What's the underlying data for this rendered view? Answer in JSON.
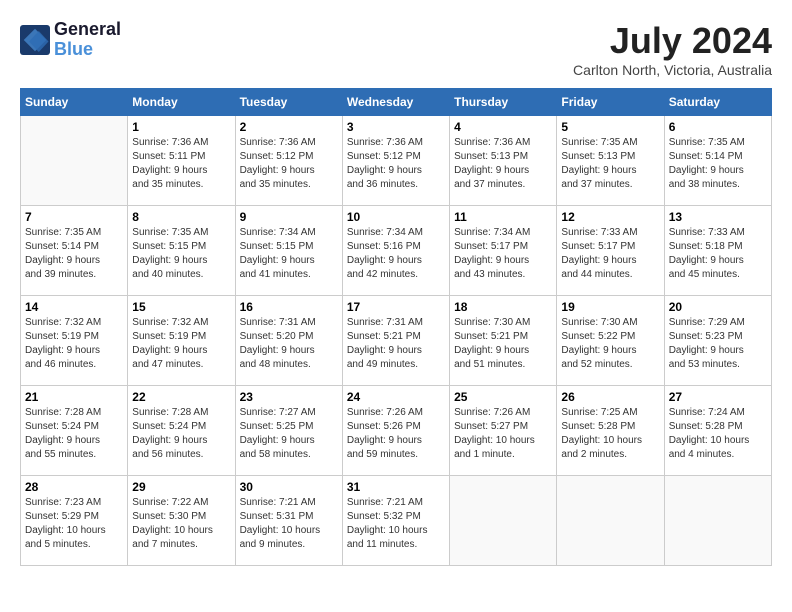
{
  "header": {
    "logo_line1": "General",
    "logo_line2": "Blue",
    "month_year": "July 2024",
    "location": "Carlton North, Victoria, Australia"
  },
  "calendar": {
    "days_of_week": [
      "Sunday",
      "Monday",
      "Tuesday",
      "Wednesday",
      "Thursday",
      "Friday",
      "Saturday"
    ],
    "weeks": [
      [
        {
          "day": "",
          "detail": ""
        },
        {
          "day": "1",
          "detail": "Sunrise: 7:36 AM\nSunset: 5:11 PM\nDaylight: 9 hours\nand 35 minutes."
        },
        {
          "day": "2",
          "detail": "Sunrise: 7:36 AM\nSunset: 5:12 PM\nDaylight: 9 hours\nand 35 minutes."
        },
        {
          "day": "3",
          "detail": "Sunrise: 7:36 AM\nSunset: 5:12 PM\nDaylight: 9 hours\nand 36 minutes."
        },
        {
          "day": "4",
          "detail": "Sunrise: 7:36 AM\nSunset: 5:13 PM\nDaylight: 9 hours\nand 37 minutes."
        },
        {
          "day": "5",
          "detail": "Sunrise: 7:35 AM\nSunset: 5:13 PM\nDaylight: 9 hours\nand 37 minutes."
        },
        {
          "day": "6",
          "detail": "Sunrise: 7:35 AM\nSunset: 5:14 PM\nDaylight: 9 hours\nand 38 minutes."
        }
      ],
      [
        {
          "day": "7",
          "detail": "Sunrise: 7:35 AM\nSunset: 5:14 PM\nDaylight: 9 hours\nand 39 minutes."
        },
        {
          "day": "8",
          "detail": "Sunrise: 7:35 AM\nSunset: 5:15 PM\nDaylight: 9 hours\nand 40 minutes."
        },
        {
          "day": "9",
          "detail": "Sunrise: 7:34 AM\nSunset: 5:15 PM\nDaylight: 9 hours\nand 41 minutes."
        },
        {
          "day": "10",
          "detail": "Sunrise: 7:34 AM\nSunset: 5:16 PM\nDaylight: 9 hours\nand 42 minutes."
        },
        {
          "day": "11",
          "detail": "Sunrise: 7:34 AM\nSunset: 5:17 PM\nDaylight: 9 hours\nand 43 minutes."
        },
        {
          "day": "12",
          "detail": "Sunrise: 7:33 AM\nSunset: 5:17 PM\nDaylight: 9 hours\nand 44 minutes."
        },
        {
          "day": "13",
          "detail": "Sunrise: 7:33 AM\nSunset: 5:18 PM\nDaylight: 9 hours\nand 45 minutes."
        }
      ],
      [
        {
          "day": "14",
          "detail": "Sunrise: 7:32 AM\nSunset: 5:19 PM\nDaylight: 9 hours\nand 46 minutes."
        },
        {
          "day": "15",
          "detail": "Sunrise: 7:32 AM\nSunset: 5:19 PM\nDaylight: 9 hours\nand 47 minutes."
        },
        {
          "day": "16",
          "detail": "Sunrise: 7:31 AM\nSunset: 5:20 PM\nDaylight: 9 hours\nand 48 minutes."
        },
        {
          "day": "17",
          "detail": "Sunrise: 7:31 AM\nSunset: 5:21 PM\nDaylight: 9 hours\nand 49 minutes."
        },
        {
          "day": "18",
          "detail": "Sunrise: 7:30 AM\nSunset: 5:21 PM\nDaylight: 9 hours\nand 51 minutes."
        },
        {
          "day": "19",
          "detail": "Sunrise: 7:30 AM\nSunset: 5:22 PM\nDaylight: 9 hours\nand 52 minutes."
        },
        {
          "day": "20",
          "detail": "Sunrise: 7:29 AM\nSunset: 5:23 PM\nDaylight: 9 hours\nand 53 minutes."
        }
      ],
      [
        {
          "day": "21",
          "detail": "Sunrise: 7:28 AM\nSunset: 5:24 PM\nDaylight: 9 hours\nand 55 minutes."
        },
        {
          "day": "22",
          "detail": "Sunrise: 7:28 AM\nSunset: 5:24 PM\nDaylight: 9 hours\nand 56 minutes."
        },
        {
          "day": "23",
          "detail": "Sunrise: 7:27 AM\nSunset: 5:25 PM\nDaylight: 9 hours\nand 58 minutes."
        },
        {
          "day": "24",
          "detail": "Sunrise: 7:26 AM\nSunset: 5:26 PM\nDaylight: 9 hours\nand 59 minutes."
        },
        {
          "day": "25",
          "detail": "Sunrise: 7:26 AM\nSunset: 5:27 PM\nDaylight: 10 hours\nand 1 minute."
        },
        {
          "day": "26",
          "detail": "Sunrise: 7:25 AM\nSunset: 5:28 PM\nDaylight: 10 hours\nand 2 minutes."
        },
        {
          "day": "27",
          "detail": "Sunrise: 7:24 AM\nSunset: 5:28 PM\nDaylight: 10 hours\nand 4 minutes."
        }
      ],
      [
        {
          "day": "28",
          "detail": "Sunrise: 7:23 AM\nSunset: 5:29 PM\nDaylight: 10 hours\nand 5 minutes."
        },
        {
          "day": "29",
          "detail": "Sunrise: 7:22 AM\nSunset: 5:30 PM\nDaylight: 10 hours\nand 7 minutes."
        },
        {
          "day": "30",
          "detail": "Sunrise: 7:21 AM\nSunset: 5:31 PM\nDaylight: 10 hours\nand 9 minutes."
        },
        {
          "day": "31",
          "detail": "Sunrise: 7:21 AM\nSunset: 5:32 PM\nDaylight: 10 hours\nand 11 minutes."
        },
        {
          "day": "",
          "detail": ""
        },
        {
          "day": "",
          "detail": ""
        },
        {
          "day": "",
          "detail": ""
        }
      ]
    ]
  }
}
